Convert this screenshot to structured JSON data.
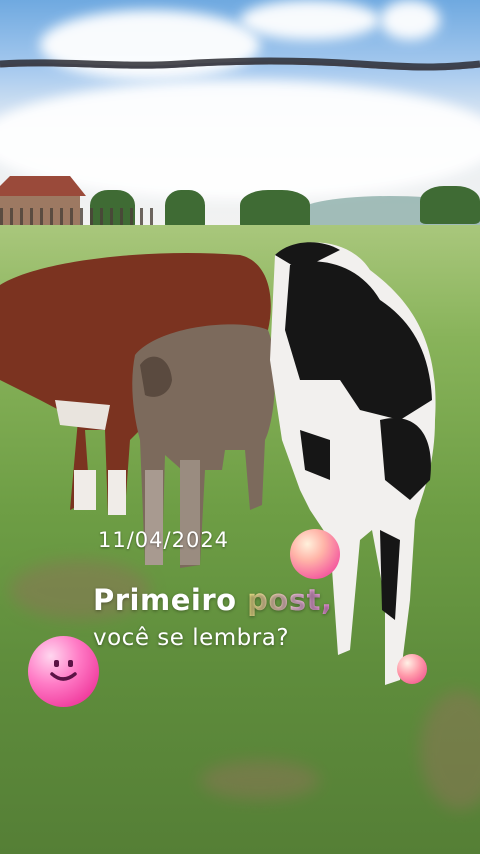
{
  "overlay": {
    "date": "11/04/2024",
    "title_part1": "Primeiro",
    "title_part2": "post,",
    "subtitle": "você se lembra?"
  },
  "icons": {
    "smiley": "smiley-face-sticker-icon",
    "bubble_large": "pink-bubble-icon",
    "bubble_small": "pink-bubble-icon"
  },
  "colors": {
    "text": "#ffffff",
    "gradient_start": "#f7f089",
    "gradient_end": "#e98bd8",
    "bubble_pink": "#f03a9d",
    "grass": "#6e9e45"
  }
}
